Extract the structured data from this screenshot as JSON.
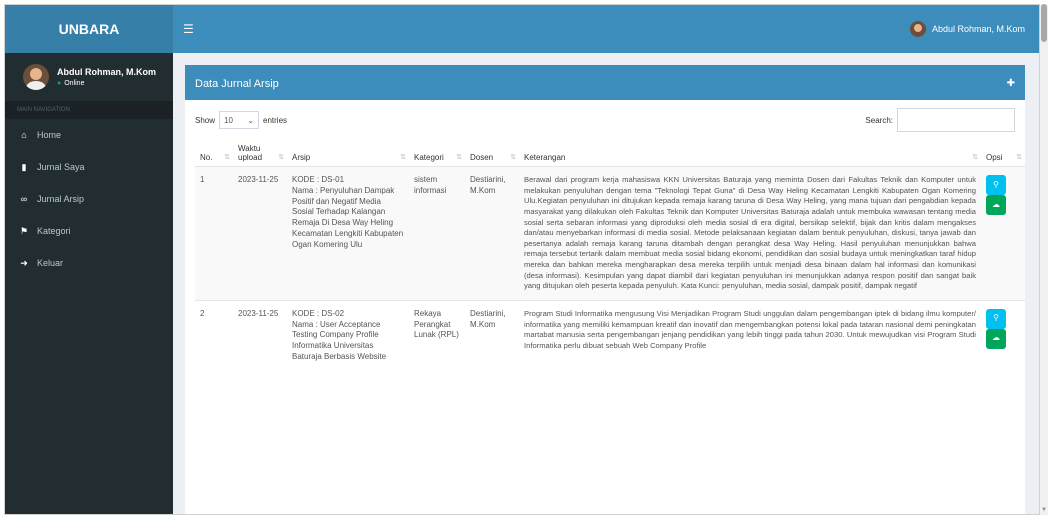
{
  "header": {
    "brand": "UNBARA",
    "toggle_icon": "bars-icon",
    "user_name": "Abdul Rohman, M.Kom"
  },
  "sidebar": {
    "user_name": "Abdul Rohman, M.Kom",
    "status": "Online",
    "nav_header": "MAIN NAVIGATION",
    "items": [
      {
        "label": "Home",
        "icon": "home-icon"
      },
      {
        "label": "Jurnal Saya",
        "icon": "book-icon"
      },
      {
        "label": "Jurnal Arsip",
        "icon": "link-icon"
      },
      {
        "label": "Kategori",
        "icon": "bookmark-icon"
      },
      {
        "label": "Keluar",
        "icon": "sign-out-icon"
      }
    ]
  },
  "box": {
    "title": "Data Jurnal Arsip",
    "tool_icon": "plus-icon"
  },
  "table_controls": {
    "show_label": "Show",
    "entries_value": "10",
    "entries_label": "entries",
    "search_label": "Search:",
    "search_value": ""
  },
  "table": {
    "columns": [
      "No.",
      "Waktu upload",
      "Arsip",
      "Kategori",
      "Dosen",
      "Keterangan",
      "Opsi"
    ],
    "rows": [
      {
        "no": "1",
        "waktu": "2023-11-25",
        "arsip": "KODE : DS-01\nNama : Penyuluhan Dampak Positif dan Negatif Media Sosial Terhadap Kalangan Remaja Di Desa Way Heling Kecamatan Lengkiti Kabupaten Ogan Komering Ulu",
        "kategori": "sistem informasi",
        "dosen": "Destiarini, M.Kom",
        "keterangan": "Berawal dari program kerja mahasiswa KKN Universitas Baturaja yang meminta Dosen dari Fakultas Teknik dan Komputer untuk melakukan penyuluhan dengan tema \"Teknologi Tepat Guna\" di Desa Way Heling Kecamatan Lengkiti Kabupaten Ogan Komering Ulu.Kegiatan penyuluhan ini ditujukan kepada remaja karang taruna di Desa Way Heling, yang mana tujuan dari pengabdian kepada masyarakat yang dilakukan oleh Fakultas Teknik dan Komputer Universitas Baturaja adalah untuk membuka wawasan tentang media sosial serta sebaran informasi yang diproduksi oleh media sosial di era digital, bersikap selektif, bijak dan kritis dalam mengakses dan/atau menyebarkan informasi di media sosial. Metode pelaksanaan kegiatan dalam bentuk penyuluhan, diskusi, tanya jawab dan pesertanya adalah remaja karang taruna ditambah dengan perangkat desa Way Heling. Hasil penyuluhan menunjukkan bahwa remaja tersebut tertarik dalam membuat media sosial bidang ekonomi, pendidikan dan sosial budaya untuk meningkatkan taraf hidup mereka dan bahkan mereka mengharapkan desa mereka terpilih untuk menjadi desa binaan dalam hal informasi dan komunikasi (desa informasi). Kesimpulan yang dapat diambil dari kegiatan penyuluhan ini menunjukkan adanya respon positif dan sangat baik yang ditujukan oleh peserta kepada penyuluh. Kata Kunci: penyuluhan, media sosial, dampak positif, dampak negatif"
      },
      {
        "no": "2",
        "waktu": "2023-11-25",
        "arsip": "KODE : DS-02\nNama : User Acceptance Testing Company Profile Informatika Universitas Baturaja Berbasis Website",
        "kategori": "Rekaya Perangkat Lunak (RPL)",
        "dosen": "Destiarini, M.Kom",
        "keterangan": "Program Studi Informatika mengusung Visi Menjadikan Program Studi unggulan dalam pengembangan iptek di bidang ilmu komputer/ informatika yang memiliki kemampuan kreatif dan inovatif dan mengembangkan potensi lokal pada tataran nasional demi peningkatan martabat manusia serta pengembangan jenjang pendidikan yang lebih tinggi pada tahun 2030. Untuk mewujudkan visi Program Studi Informatika perlu dibuat sebuah Web Company Profile"
      }
    ],
    "actions": {
      "view_icon": "search-icon",
      "download_icon": "cloud-download-icon"
    }
  },
  "colors": {
    "navbar": "#3c8dbc",
    "logo": "#367fa9",
    "sidebar": "#222d32",
    "btn_info": "#00c0ef",
    "btn_success": "#00a65a"
  }
}
